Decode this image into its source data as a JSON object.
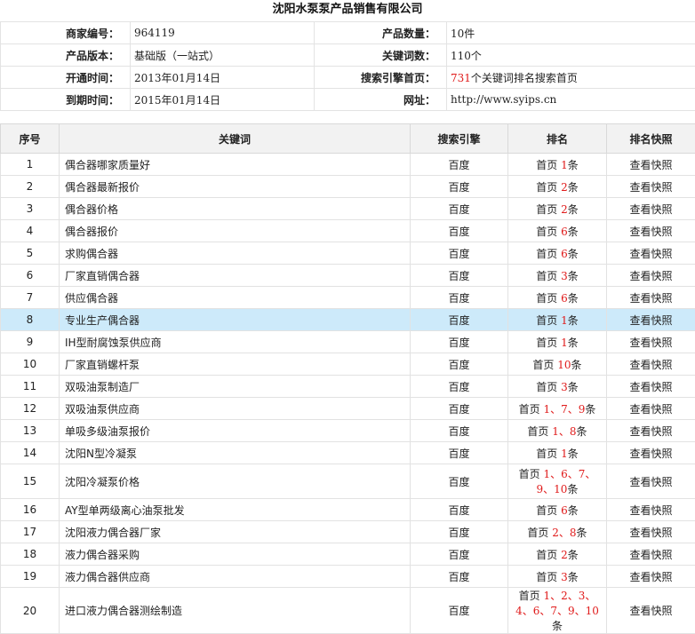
{
  "title": "沈阳水泵泵产品销售有限公司",
  "info": {
    "merchant_id_label": "商家编号：",
    "merchant_id": "964119",
    "product_count_label": "产品数量：",
    "product_count": "10件",
    "version_label": "产品版本：",
    "version": "基础版（一站式）",
    "keyword_count_label": "关键词数：",
    "keyword_count": "110个",
    "open_time_label": "开通时间：",
    "open_time": "2013年01月14日",
    "search_home_label": "搜索引擎首页：",
    "search_home_num": "731",
    "search_home_text": "个关键词排名搜索首页",
    "expire_time_label": "到期时间：",
    "expire_time": "2015年01月14日",
    "url_label": "网址：",
    "url": "http://www.syips.cn"
  },
  "table": {
    "headers": [
      "序号",
      "关键词",
      "搜索引擎",
      "排名",
      "排名快照"
    ],
    "rows": [
      {
        "idx": "1",
        "keyword": "偶合器哪家质量好",
        "engine": "百度",
        "rank_prefix": "首页",
        "rank": "1",
        "rank_suffix": "条",
        "snapshot": "查看快照"
      },
      {
        "idx": "2",
        "keyword": "偶合器最新报价",
        "engine": "百度",
        "rank_prefix": "首页",
        "rank": "2",
        "rank_suffix": "条",
        "snapshot": "查看快照"
      },
      {
        "idx": "3",
        "keyword": "偶合器价格",
        "engine": "百度",
        "rank_prefix": "首页",
        "rank": "2",
        "rank_suffix": "条",
        "snapshot": "查看快照"
      },
      {
        "idx": "4",
        "keyword": "偶合器报价",
        "engine": "百度",
        "rank_prefix": "首页",
        "rank": "6",
        "rank_suffix": "条",
        "snapshot": "查看快照"
      },
      {
        "idx": "5",
        "keyword": "求购偶合器",
        "engine": "百度",
        "rank_prefix": "首页",
        "rank": "6",
        "rank_suffix": "条",
        "snapshot": "查看快照"
      },
      {
        "idx": "6",
        "keyword": "厂家直销偶合器",
        "engine": "百度",
        "rank_prefix": "首页",
        "rank": "3",
        "rank_suffix": "条",
        "snapshot": "查看快照"
      },
      {
        "idx": "7",
        "keyword": "供应偶合器",
        "engine": "百度",
        "rank_prefix": "首页",
        "rank": "6",
        "rank_suffix": "条",
        "snapshot": "查看快照"
      },
      {
        "idx": "8",
        "keyword": "专业生产偶合器",
        "engine": "百度",
        "rank_prefix": "首页",
        "rank": "1",
        "rank_suffix": "条",
        "snapshot": "查看快照"
      },
      {
        "idx": "9",
        "keyword": "IH型耐腐蚀泵供应商",
        "engine": "百度",
        "rank_prefix": "首页",
        "rank": "1",
        "rank_suffix": "条",
        "snapshot": "查看快照"
      },
      {
        "idx": "10",
        "keyword": "厂家直销螺杆泵",
        "engine": "百度",
        "rank_prefix": "首页",
        "rank": "10",
        "rank_suffix": "条",
        "snapshot": "查看快照"
      },
      {
        "idx": "11",
        "keyword": "双吸油泵制造厂",
        "engine": "百度",
        "rank_prefix": "首页",
        "rank": "3",
        "rank_suffix": "条",
        "snapshot": "查看快照"
      },
      {
        "idx": "12",
        "keyword": "双吸油泵供应商",
        "engine": "百度",
        "rank_prefix": "首页",
        "rank": "1、7、9",
        "rank_suffix": "条",
        "snapshot": "查看快照"
      },
      {
        "idx": "13",
        "keyword": "单吸多级油泵报价",
        "engine": "百度",
        "rank_prefix": "首页",
        "rank": "1、8",
        "rank_suffix": "条",
        "snapshot": "查看快照"
      },
      {
        "idx": "14",
        "keyword": "沈阳N型冷凝泵",
        "engine": "百度",
        "rank_prefix": "首页",
        "rank": "1",
        "rank_suffix": "条",
        "snapshot": "查看快照"
      },
      {
        "idx": "15",
        "keyword": "沈阳冷凝泵价格",
        "engine": "百度",
        "rank_prefix": "首页",
        "rank": "1、6、7、",
        "rank2": "9、10",
        "rank_suffix": "条",
        "snapshot": "查看快照",
        "tall": true
      },
      {
        "idx": "16",
        "keyword": "AY型单两级离心油泵批发",
        "engine": "百度",
        "rank_prefix": "首页",
        "rank": "6",
        "rank_suffix": "条",
        "snapshot": "查看快照"
      },
      {
        "idx": "17",
        "keyword": "沈阳液力偶合器厂家",
        "engine": "百度",
        "rank_prefix": "首页",
        "rank": "2、8",
        "rank_suffix": "条",
        "snapshot": "查看快照"
      },
      {
        "idx": "18",
        "keyword": "液力偶合器采购",
        "engine": "百度",
        "rank_prefix": "首页",
        "rank": "2",
        "rank_suffix": "条",
        "snapshot": "查看快照"
      },
      {
        "idx": "19",
        "keyword": "液力偶合器供应商",
        "engine": "百度",
        "rank_prefix": "首页",
        "rank": "3",
        "rank_suffix": "条",
        "snapshot": "查看快照"
      },
      {
        "idx": "20",
        "keyword": "进口液力偶合器测绘制造",
        "engine": "百度",
        "rank_prefix": "首页",
        "rank": "1、2、3、",
        "rank2": "4、6、7、9、10",
        "rank_suffix": "条",
        "snapshot": "查看快照",
        "tall": true
      }
    ]
  },
  "selected_row": "8",
  "colors": {
    "rank_red": "#e01b1b",
    "selected_bg": "#cdeafa",
    "header_bg": "#f2f2f2"
  }
}
